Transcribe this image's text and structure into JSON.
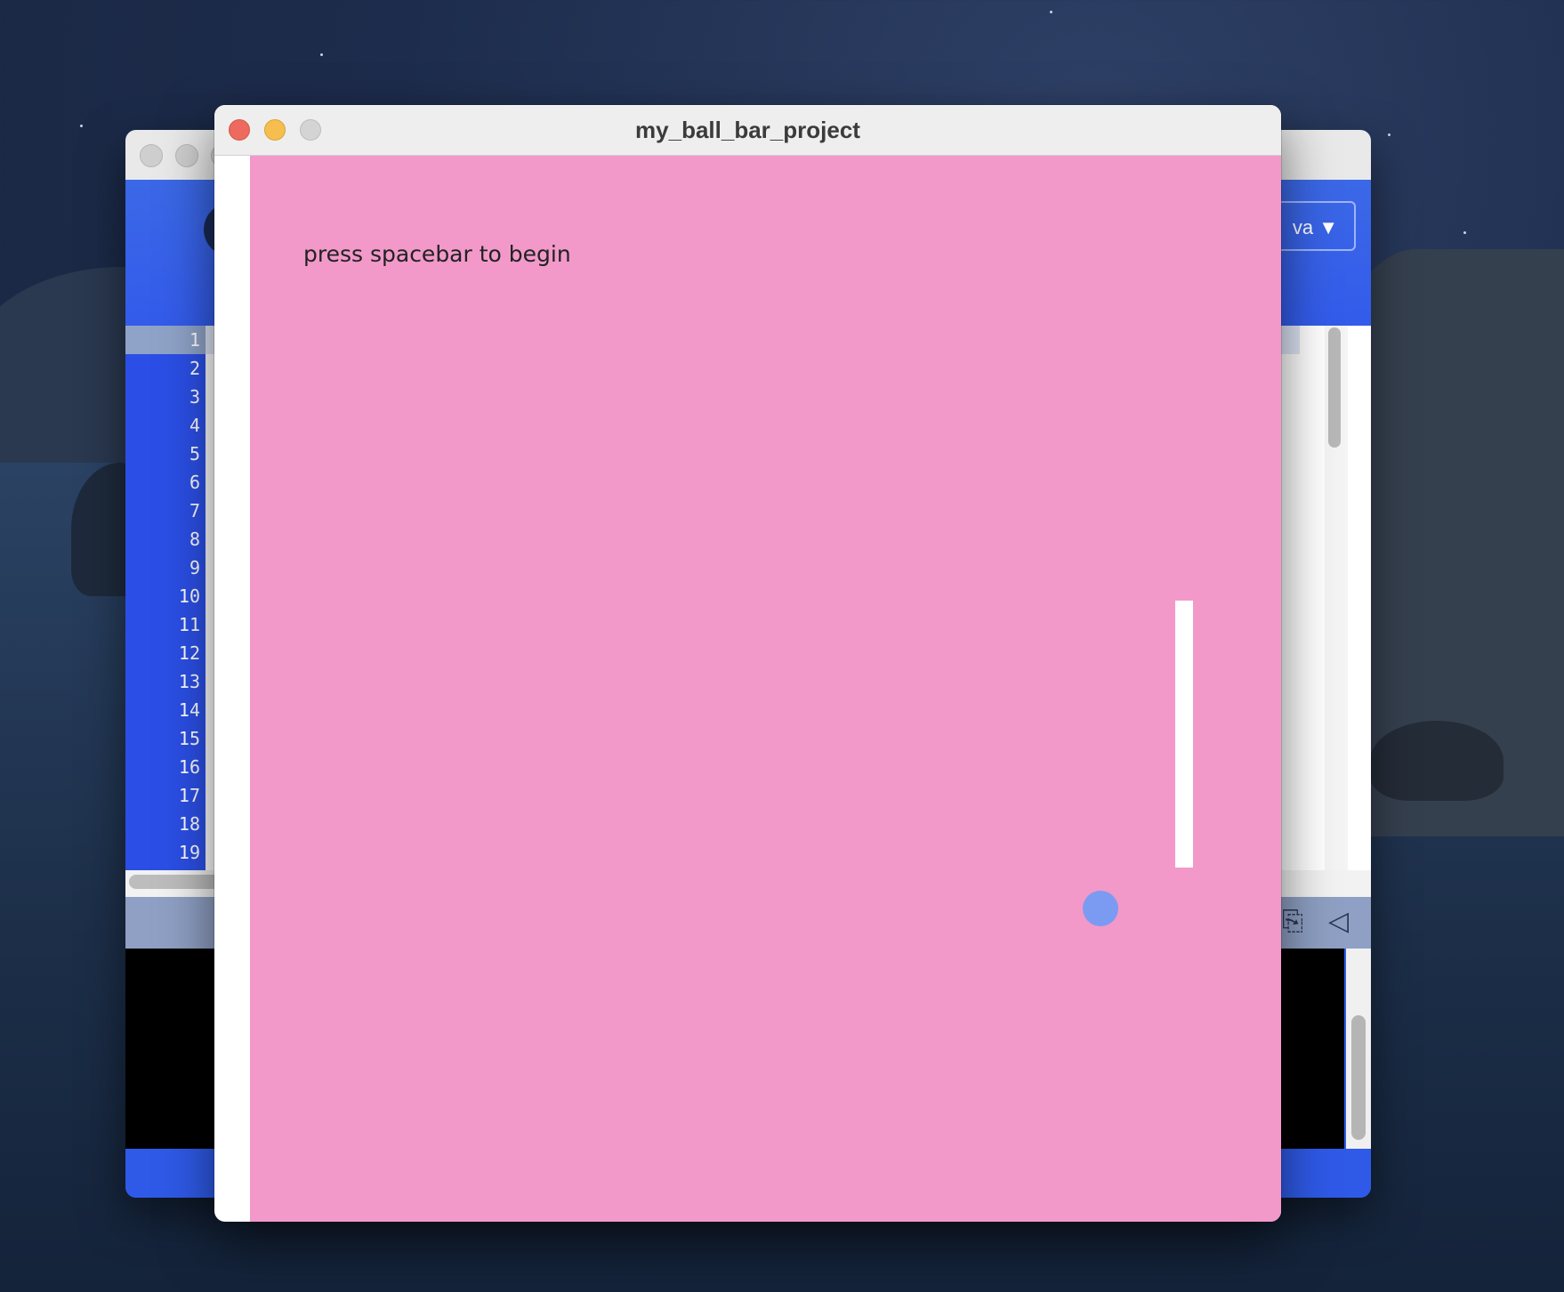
{
  "sketch_window": {
    "title": "my_ball_bar_project",
    "canvas_message": "press spacebar to begin",
    "colors": {
      "background": "#f299ca",
      "ball": "#7b9bf2",
      "paddle": "#ffffff",
      "text": "#222222"
    }
  },
  "ide_window": {
    "mode_selector_label": "va ▼",
    "line_numbers": [
      "1",
      "2",
      "3",
      "4",
      "5",
      "6",
      "7",
      "8",
      "9",
      "10",
      "11",
      "12",
      "13",
      "14",
      "15",
      "16",
      "17",
      "18",
      "19"
    ],
    "toolbar_icons": [
      "copy-icon",
      "collapse-icon"
    ]
  }
}
